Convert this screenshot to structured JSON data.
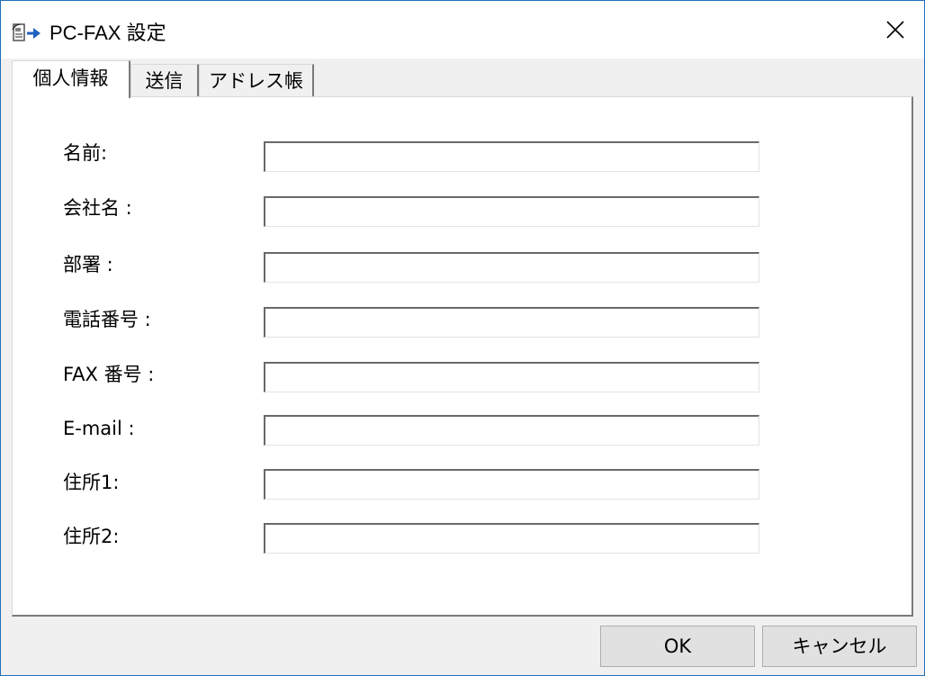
{
  "window": {
    "title": "PC-FAX 設定",
    "accent_color": "#1e6fb8"
  },
  "tabs": [
    {
      "label": "個人情報",
      "active": true
    },
    {
      "label": "送信",
      "active": false
    },
    {
      "label": "アドレス帳",
      "active": false
    }
  ],
  "form": {
    "fields": [
      {
        "label": "名前:",
        "value": ""
      },
      {
        "label": "会社名 :",
        "value": ""
      },
      {
        "label": "部署 :",
        "value": ""
      },
      {
        "label": "電話番号 :",
        "value": ""
      },
      {
        "label": "FAX 番号 :",
        "value": ""
      },
      {
        "label": "E-mail :",
        "value": ""
      },
      {
        "label": "住所1:",
        "value": ""
      },
      {
        "label": "住所2:",
        "value": ""
      }
    ]
  },
  "buttons": {
    "ok_label": "OK",
    "cancel_label": "キャンセル"
  },
  "icons": {
    "app": "pc-fax-icon",
    "close": "close-icon"
  }
}
